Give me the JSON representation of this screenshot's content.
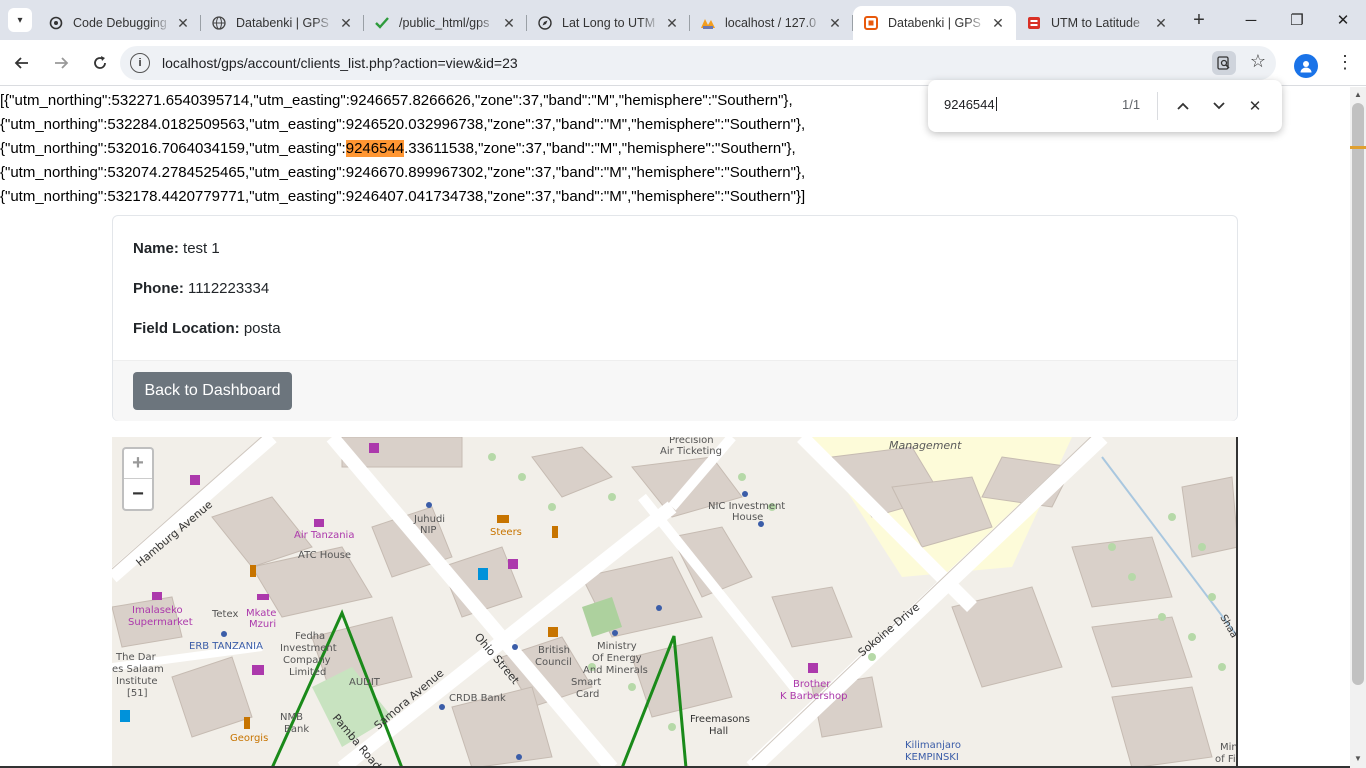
{
  "browser": {
    "tabs": [
      {
        "title": "Code Debugging",
        "icon": "openai-icon",
        "active": false
      },
      {
        "title": "Databenki | GPS",
        "icon": "globe-icon",
        "active": false
      },
      {
        "title": "/public_html/gps",
        "icon": "checkmark-icon",
        "active": false
      },
      {
        "title": "Lat Long to UTM",
        "icon": "compass-icon",
        "active": false
      },
      {
        "title": "localhost / 127.0",
        "icon": "phpmyadmin-icon",
        "active": false
      },
      {
        "title": "Databenki | GPS",
        "icon": "app-icon",
        "active": true
      },
      {
        "title": "UTM to Latitude",
        "icon": "toolbox-icon",
        "active": false
      }
    ],
    "url": "localhost/gps/account/clients_list.php?action=view&id=23"
  },
  "find_bar": {
    "query": "9246544",
    "count": "1/1"
  },
  "json_output": {
    "line1": "[{\"utm_northing\":532271.6540395714,\"utm_easting\":9246657.8266626,\"zone\":37,\"band\":\"M\",\"hemisphere\":\"Southern\"},",
    "line2": "{\"utm_northing\":532284.0182509563,\"utm_easting\":9246520.032996738,\"zone\":37,\"band\":\"M\",\"hemisphere\":\"Southern\"},",
    "line3_before": "{\"utm_northing\":532016.7064034159,\"utm_easting\":",
    "line3_match": "9246544",
    "line3_after": ".33611538,\"zone\":37,\"band\":\"M\",\"hemisphere\":\"Southern\"},",
    "line4": "{\"utm_northing\":532074.2784525465,\"utm_easting\":9246670.899967302,\"zone\":37,\"band\":\"M\",\"hemisphere\":\"Southern\"},",
    "line5": "{\"utm_northing\":532178.4420779771,\"utm_easting\":9246407.041734738,\"zone\":37,\"band\":\"M\",\"hemisphere\":\"Southern\"}]"
  },
  "client": {
    "name_label": "Name:",
    "name": "test 1",
    "phone_label": "Phone:",
    "phone": "1112223334",
    "location_label": "Field Location:",
    "location": "posta",
    "back_button": "Back to Dashboard"
  },
  "map": {
    "zoom_in": "+",
    "zoom_out": "−",
    "labels": [
      "Management",
      "Precision",
      "Air Ticketing",
      "Hamburg Avenue",
      "Air Tanzania",
      "ATC House",
      "Juhudi",
      "NIP",
      "Steers",
      "NIC Investment",
      "House",
      "Imalaseko",
      "Supermarket",
      "Tetex",
      "Mkate",
      "Mzuri",
      "ERB TANZANIA",
      "Fedha",
      "Investment",
      "Company",
      "Limited",
      "The Dar",
      "es Salaam",
      "Institute",
      "[51]",
      "AUDIT",
      "NMB",
      "Bank",
      "Pamba Road",
      "Samora Avenue",
      "Georgis",
      "CRDB Bank",
      "Ohio Street",
      "British",
      "Council",
      "Ministry",
      "Of Energy",
      "And Minerals",
      "Smart",
      "Card",
      "Freemasons",
      "Hall",
      "Brother",
      "K Barbershop",
      "Sokoine Drive",
      "Kilimanjaro",
      "KEMPINSKI",
      "Shaa",
      "Min",
      "of Fi"
    ]
  }
}
